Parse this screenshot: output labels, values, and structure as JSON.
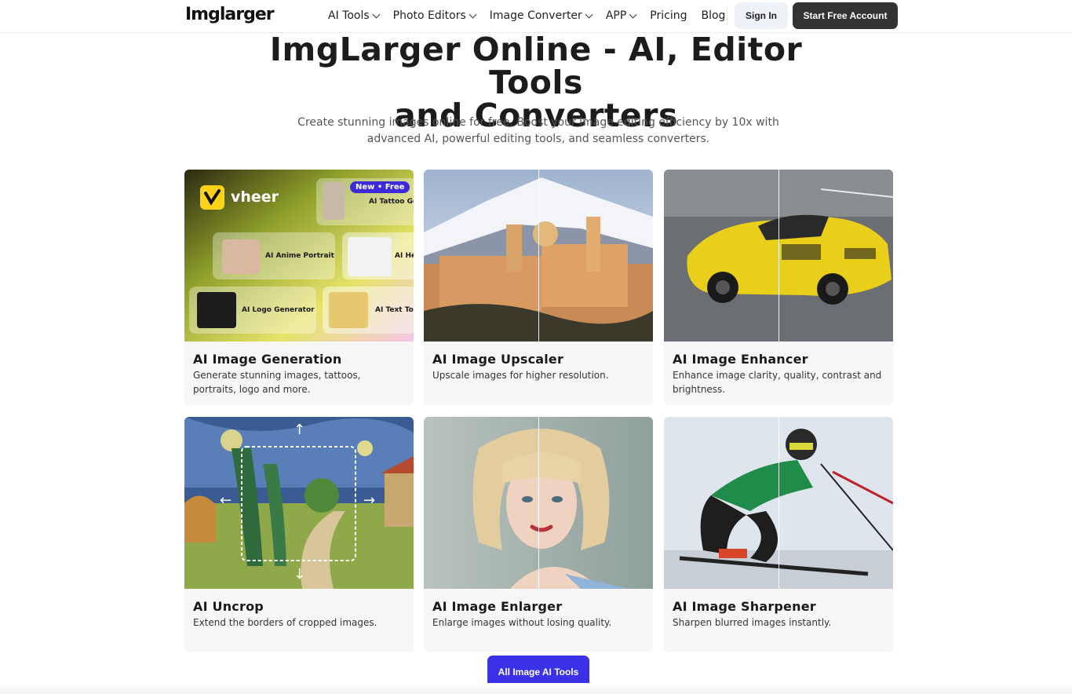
{
  "header": {
    "logo": "Imglarger",
    "nav": [
      {
        "label": "AI Tools",
        "dropdown": true
      },
      {
        "label": "Photo Editors",
        "dropdown": true
      },
      {
        "label": "Image Converter",
        "dropdown": true
      },
      {
        "label": "APP",
        "dropdown": true
      },
      {
        "label": "Pricing",
        "dropdown": false
      },
      {
        "label": "Blog",
        "dropdown": false
      }
    ],
    "sign_in": "Sign In",
    "start": "Start Free Account"
  },
  "hero": {
    "title_line1": "ImgLarger Online - AI, Editor Tools",
    "title_line2": "and Converters",
    "subtitle": "Create stunning images online for free. Boost your image editing efficiency by 10x with advanced AI, powerful editing tools, and seamless converters."
  },
  "vheer": {
    "brand": "vheer",
    "badge": "New • Free",
    "tiles": [
      "AI Tattoo Ge",
      "AI Anime Portrait",
      "AI He",
      "AI Logo Generator",
      "AI Text To I"
    ]
  },
  "cards": [
    {
      "title": "AI Image Generation",
      "desc": "Generate stunning images, tattoos, portraits, logo and more."
    },
    {
      "title": "AI Image Upscaler",
      "desc": "Upscale images for higher resolution."
    },
    {
      "title": "AI Image Enhancer",
      "desc": "Enhance image clarity, quality, contrast and brightness."
    },
    {
      "title": "AI Uncrop",
      "desc": "Extend the borders of cropped images."
    },
    {
      "title": "AI Image Enlarger",
      "desc": "Enlarge images without losing quality."
    },
    {
      "title": "AI Image Sharpener",
      "desc": "Sharpen blurred images instantly."
    }
  ],
  "all_tools": "All Image AI Tools",
  "colors": {
    "accent": "#3a31e8",
    "dark_button": "#333333"
  }
}
